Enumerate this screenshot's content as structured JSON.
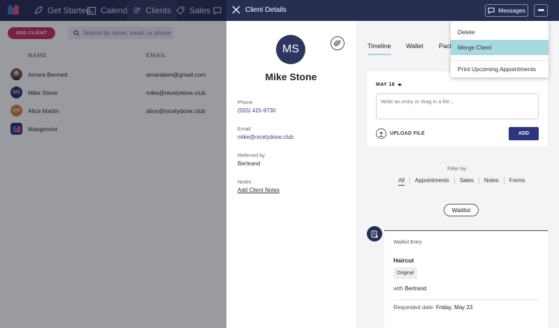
{
  "nav": {
    "items": [
      {
        "label": "Get Started",
        "icon": "rocket-icon"
      },
      {
        "label": "Calendar",
        "icon": "calendar-icon"
      },
      {
        "label": "Clients",
        "icon": "users-icon"
      },
      {
        "label": "Sales",
        "icon": "tag-icon"
      },
      {
        "label": "M",
        "icon": "chat-icon"
      }
    ],
    "calendar_day": "31"
  },
  "clients_page": {
    "add_client_label": "ADD CLIENT",
    "search_placeholder": "Search by name, email, or phone",
    "columns": [
      "NAME",
      "EMAIL"
    ],
    "rows": [
      {
        "initials": "",
        "name": "Amara Bennett",
        "email": "amaraben@gmail.com",
        "avatar_color": "#6b5a52"
      },
      {
        "initials": "MS",
        "name": "Mike Stone",
        "email": "mike@nicelydone.club",
        "avatar_color": "#2d3560"
      },
      {
        "initials": "AM",
        "name": "Alice Martin",
        "email": "alice@nicelydone.club",
        "avatar_color": "#d9823f"
      },
      {
        "initials": "",
        "name": "Mangomint",
        "email": "",
        "avatar_color": "#2d3560"
      }
    ]
  },
  "drawer": {
    "title": "Client Details",
    "messages_label": "Messages",
    "more_label": "•••"
  },
  "profile": {
    "initials": "MS",
    "name": "Mike Stone",
    "phone_label": "Phone",
    "phone": "(555) 415-9730",
    "email_label": "Email",
    "email": "mike@nicelydone.club",
    "referred_label": "Referred by",
    "referred_by": "Berteand",
    "notes_label": "Notes",
    "add_notes_label": "Add Client Notes"
  },
  "timeline": {
    "tabs": [
      "Timeline",
      "Wallet",
      "Pack"
    ],
    "date": "MAY 18",
    "entry_placeholder": "Write an entry or drag in a file...",
    "upload_label": "UPLOAD FILE",
    "add_label": "ADD",
    "filter_label": "Filter by:",
    "filters": [
      "All",
      "Appointments",
      "Sales",
      "Notes",
      "Forms"
    ],
    "waitlist_label": "Waitlist",
    "entry": {
      "heading": "Waitlist Entry",
      "service": "Haircut",
      "badge": "Original",
      "with_prefix": "with",
      "staff": "Bertrand",
      "requested_prefix": "Requested date:",
      "requested_date": "Friday, May 23"
    }
  },
  "menu": {
    "items": [
      "Delete",
      "Merge Client",
      "Print Upcoming Appointments"
    ]
  },
  "colors": {
    "nav_bg": "#262e52",
    "accent_pink": "#c6305f",
    "menu_hover": "#a8d8e0",
    "primary_button": "#2d3580"
  }
}
